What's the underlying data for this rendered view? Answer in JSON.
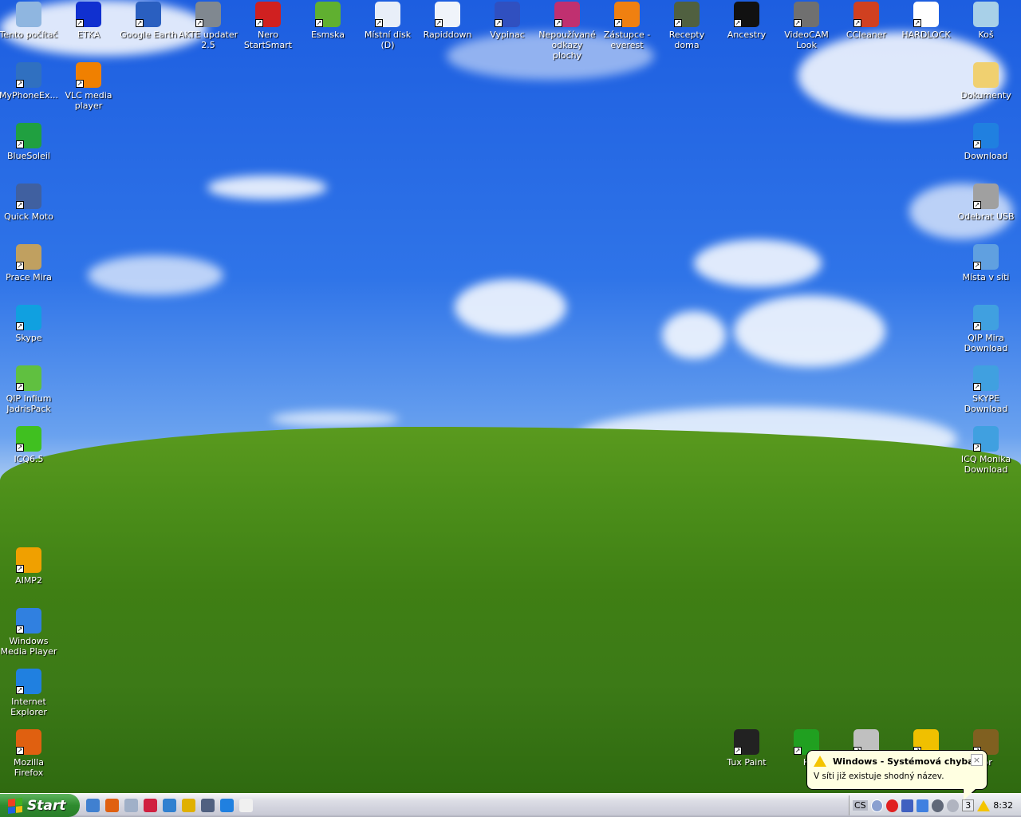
{
  "desktop_icons": [
    {
      "label": "Tento počítač",
      "icon": "my-computer-icon",
      "color": "#8fb6e0"
    },
    {
      "label": "ETKA",
      "icon": "etka-icon",
      "color": "#1030d0"
    },
    {
      "label": "Google Earth",
      "icon": "google-earth-icon",
      "color": "#2a5fc0"
    },
    {
      "label": "AKTE updater 2.5",
      "icon": "akte-icon",
      "color": "#808890"
    },
    {
      "label": "Nero StartSmart",
      "icon": "nero-icon",
      "color": "#d02020"
    },
    {
      "label": "Esmska",
      "icon": "esmska-icon",
      "color": "#60b030"
    },
    {
      "label": "Místní disk (D)",
      "icon": "drive-icon",
      "color": "#e8eef8"
    },
    {
      "label": "Rapiddown",
      "icon": "rapiddown-icon",
      "color": "#f0f4fa"
    },
    {
      "label": "Vypinac",
      "icon": "switch-icon",
      "color": "#3050c0"
    },
    {
      "label": "Nepoužívané odkazy plochy",
      "icon": "unused-shortcuts-icon",
      "color": "#c03070"
    },
    {
      "label": "Zástupce - everest",
      "icon": "everest-icon",
      "color": "#f08010"
    },
    {
      "label": "Recepty doma",
      "icon": "cauldron-icon",
      "color": "#506040"
    },
    {
      "label": "Ancestry",
      "icon": "ancestry-icon",
      "color": "#111111"
    },
    {
      "label": "VideoCAM Look",
      "icon": "camera-icon",
      "color": "#707070"
    },
    {
      "label": "CCleaner",
      "icon": "ccleaner-icon",
      "color": "#d04020"
    },
    {
      "label": "HARDLOCK",
      "icon": "lexcom-icon",
      "color": "#ffffff"
    },
    {
      "label": "Koš",
      "icon": "recycle-bin-icon",
      "color": "#a8d0e8"
    },
    {
      "label": "MyPhoneEx...",
      "icon": "myphoneexplorer-icon",
      "color": "#3070c0"
    },
    {
      "label": "VLC media player",
      "icon": "vlc-icon",
      "color": "#f08000"
    },
    {
      "label": "BlueSoleil",
      "icon": "bluetooth-icon",
      "color": "#20a040"
    },
    {
      "label": "Quick Moto",
      "icon": "quick-moto-icon",
      "color": "#4060a0"
    },
    {
      "label": "Prace Mira",
      "icon": "calendar-icon",
      "color": "#c0a060"
    },
    {
      "label": "Skype",
      "icon": "skype-icon",
      "color": "#10a0e0"
    },
    {
      "label": "QIP Infium JadrisPack",
      "icon": "qip-icon",
      "color": "#60c040"
    },
    {
      "label": "ICQ6.5",
      "icon": "icq-icon",
      "color": "#40c020"
    },
    {
      "label": "AIMP2",
      "icon": "aimp-icon",
      "color": "#f0a000"
    },
    {
      "label": "Windows Media Player",
      "icon": "media-player-icon",
      "color": "#3080e0"
    },
    {
      "label": "Internet Explorer",
      "icon": "ie-icon",
      "color": "#2080e0"
    },
    {
      "label": "Mozilla Firefox",
      "icon": "firefox-icon",
      "color": "#e06010"
    },
    {
      "label": "Dokumenty",
      "icon": "folder-icon",
      "color": "#f0d070"
    },
    {
      "label": "Download",
      "icon": "ie-icon",
      "color": "#2080e0"
    },
    {
      "label": "Odebrat USB",
      "icon": "usb-icon",
      "color": "#a0a0a0"
    },
    {
      "label": "Místa v síti",
      "icon": "network-places-icon",
      "color": "#60a0e0"
    },
    {
      "label": "QIP Mira Download",
      "icon": "globe-icon",
      "color": "#40a0e0"
    },
    {
      "label": "SKYPE Download",
      "icon": "globe-icon",
      "color": "#40a0e0"
    },
    {
      "label": "ICQ Monika Download",
      "icon": "globe-icon",
      "color": "#40a0e0"
    },
    {
      "label": "Tux Paint",
      "icon": "tux-icon",
      "color": "#222222"
    },
    {
      "label": "H",
      "icon": "play-icon",
      "color": "#20a020"
    },
    {
      "label": "",
      "icon": "menu-icon",
      "color": "#c0c0c0"
    },
    {
      "label": "",
      "icon": "grid-game-icon",
      "color": "#f0c000"
    },
    {
      "label": "tor",
      "icon": "creature-icon",
      "color": "#806020"
    }
  ],
  "taskbar": {
    "start_label": "Start",
    "quick_launch": [
      {
        "icon": "show-desktop-icon",
        "color": "#4080d0"
      },
      {
        "icon": "firefox-icon",
        "color": "#e06010"
      },
      {
        "icon": "calculator-icon",
        "color": "#a0b0c8"
      },
      {
        "icon": "flag-app-icon",
        "color": "#d02040"
      },
      {
        "icon": "sync-icon",
        "color": "#3080d0"
      },
      {
        "icon": "chain-icon",
        "color": "#e0b000"
      },
      {
        "icon": "thunderbird-icon",
        "color": "#506080"
      },
      {
        "icon": "ie-icon",
        "color": "#2080e0"
      },
      {
        "icon": "document-icon",
        "color": "#f0f0f0"
      }
    ],
    "tray": {
      "language": "CS",
      "counter": "3",
      "clock": "8:32"
    }
  },
  "balloon": {
    "title": "Windows - Systémová chyba",
    "message": "V síti již existuje shodný název.",
    "close": "×"
  }
}
